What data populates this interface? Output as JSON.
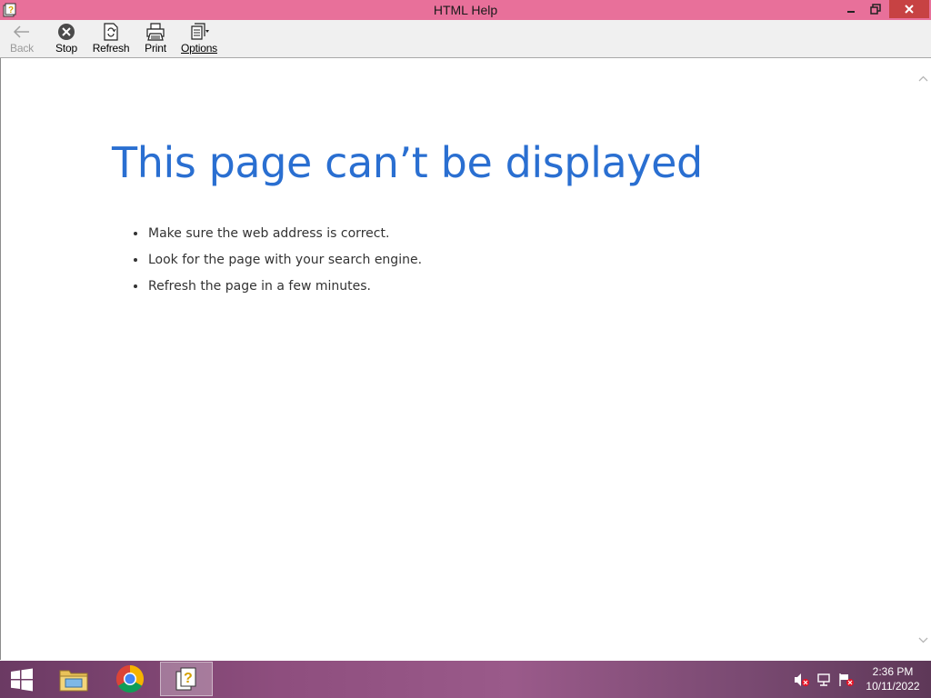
{
  "window": {
    "title": "HTML Help"
  },
  "toolbar": {
    "back_label": "Back",
    "stop_label": "Stop",
    "refresh_label": "Refresh",
    "print_label": "Print",
    "options_label": "Options"
  },
  "content": {
    "heading": "This page can’t be displayed",
    "tips": [
      "Make sure the web address  is correct.",
      "Look for the page with your search engine.",
      "Refresh the page in a few minutes."
    ]
  },
  "taskbar": {
    "apps": [
      "file-explorer",
      "chrome",
      "html-help"
    ],
    "clock": {
      "time": "2:36 PM",
      "date": "10/11/2022"
    }
  },
  "colors": {
    "titlebar": "#e8709a",
    "heading": "#2a6fd1",
    "close_button": "#c74243"
  }
}
